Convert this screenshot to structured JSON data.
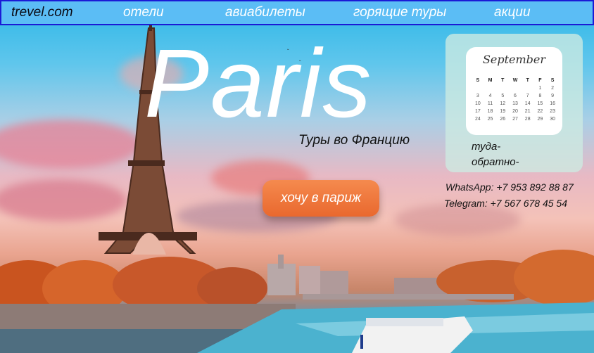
{
  "nav": {
    "brand": "trevel.com",
    "items": [
      "отели",
      "авиабилеты",
      "горящие туры",
      "акции"
    ]
  },
  "hero": {
    "title": "Paris",
    "subtitle": "Туры во Францию",
    "cta_label": "хочу в париж"
  },
  "calendar": {
    "month": "September",
    "weekdays": [
      "S",
      "M",
      "T",
      "W",
      "T",
      "F",
      "S"
    ],
    "days": [
      "",
      "",
      "",
      "",
      "",
      "1",
      "2",
      "3",
      "4",
      "5",
      "6",
      "7",
      "8",
      "9",
      "10",
      "11",
      "12",
      "13",
      "14",
      "15",
      "16",
      "17",
      "18",
      "19",
      "20",
      "21",
      "22",
      "23",
      "24",
      "25",
      "26",
      "27",
      "28",
      "29",
      "30"
    ]
  },
  "trip": {
    "there": "туда-",
    "back": "обратно-"
  },
  "contacts": {
    "whatsapp": "WhatsApp: +7 953 892 88 87",
    "telegram": "Telegram: +7 567 678 45 54"
  },
  "colors": {
    "nav_bg": "#5bbdf5",
    "nav_border": "#1b1bd6",
    "cta": "#f07a3e"
  }
}
